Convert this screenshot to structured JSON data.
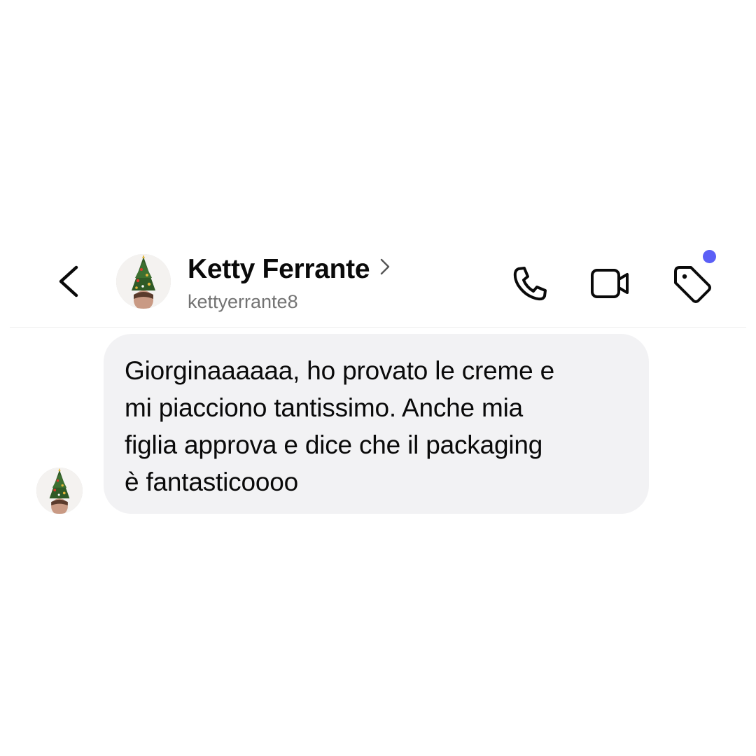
{
  "header": {
    "contact_name": "Ketty Ferrante",
    "username": "kettyerrante8",
    "back_icon": "chevron-left-icon",
    "name_chevron_icon": "chevron-right-icon",
    "actions": [
      {
        "name": "call",
        "icon": "phone-icon"
      },
      {
        "name": "video",
        "icon": "video-camera-icon"
      },
      {
        "name": "tag",
        "icon": "tag-icon",
        "has_notification_dot": true
      }
    ],
    "notification_dot_color": "#5b5ff6"
  },
  "messages": [
    {
      "direction": "incoming",
      "text": "Giorginaaaaaa, ho provato le creme e\nmi piacciono tantissimo. Anche mia\nfiglia approva e dice che il packaging\nè fantasticoooo"
    }
  ],
  "colors": {
    "bubble_background": "#f2f2f4",
    "username_text": "#737373",
    "divider": "#efefef"
  }
}
